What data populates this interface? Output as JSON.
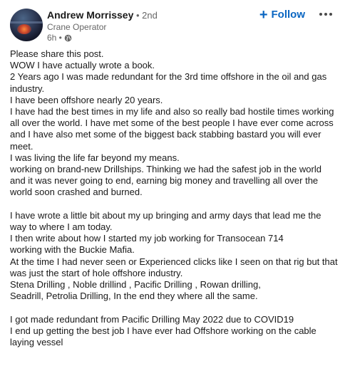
{
  "author": {
    "name": "Andrew Morrissey",
    "degree": " • 2nd",
    "title": "Crane Operator",
    "time": "6h •",
    "visibility_icon": "globe-icon"
  },
  "actions": {
    "follow_label": "Follow",
    "follow_icon": "plus-icon",
    "more_icon": "more-options-icon"
  },
  "post": {
    "lines": [
      "Please share this post.",
      "WOW I have actually wrote a book.",
      "2 Years ago I was made redundant for the 3rd time offshore in the oil and gas industry.",
      "I have been offshore nearly 20 years.",
      "I have had the best times in my life and also so really bad hostile times working all over the world. I have met some of the best people I have ever come across and I have also met some of the biggest back stabbing bastard you will ever meet.",
      "I was living the life far beyond my means.",
      "working on brand-new Drillships. Thinking we had the safest job in the world and it was never going to end, earning big money and travelling all over the world soon crashed and burned.",
      "",
      "I have wrote a little bit about my up bringing and army days that lead me the way to where I am today.",
      "I then write about how I started my job working for Transocean 714",
      "working with the Buckie Mafia.",
      "At the time I had never seen or Experienced clicks like I seen on that rig but that was just the start of hole offshore industry.",
      "Stena Drilling , Noble drillind , Pacific Drilling , Rowan drilling,",
      "Seadrill, Petrolia Drilling, In the end they where all the same.",
      "",
      "I got made redundant from Pacific Drilling May 2022 due to COVID19",
      "I end up getting the best job I have ever had Offshore working on the cable laying vessel"
    ]
  },
  "colors": {
    "accent": "#0a66c2",
    "muted": "#666666"
  }
}
